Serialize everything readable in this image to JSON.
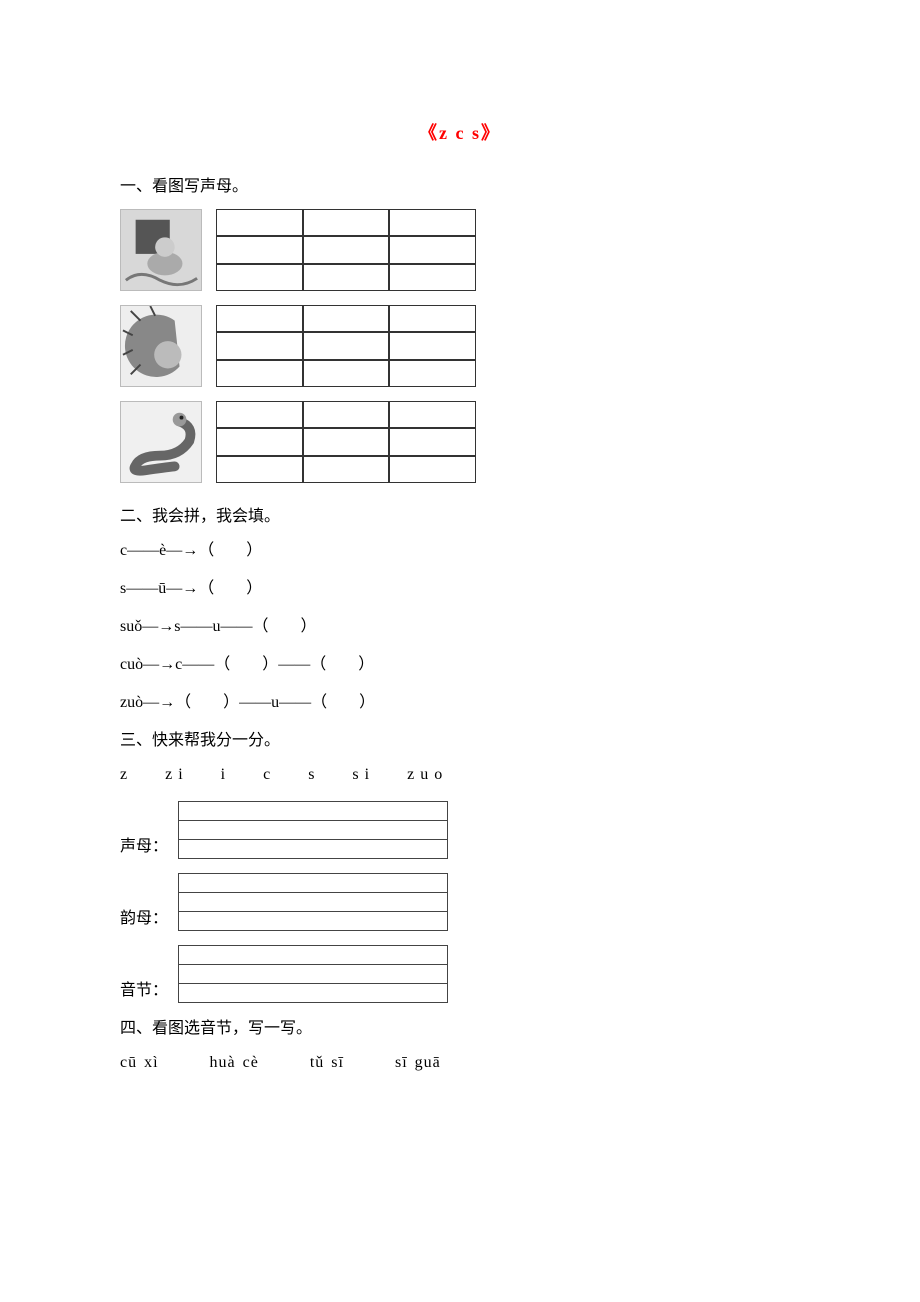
{
  "title": "《z c s》",
  "sections": {
    "s1": {
      "heading": "一、看图写声母。"
    },
    "s2": {
      "heading": "二、我会拼，我会填。",
      "lines": [
        "c——è—→（　　）",
        "s——ū—→（　　）",
        "suǒ—→s——u——（　　）",
        "cuò—→c——（　　）——（　　）",
        "zuò—→（　　）——u——（　　）"
      ]
    },
    "s3": {
      "heading": "三、快来帮我分一分。",
      "letters": "z  zi  i  c  s  si  zuo",
      "categories": [
        "声母：",
        "韵母：",
        "音节："
      ]
    },
    "s4": {
      "heading": "四、看图选音节，写一写。",
      "words": [
        "cū xì",
        "huà cè",
        "tǔ sī",
        "sī guā"
      ]
    }
  }
}
